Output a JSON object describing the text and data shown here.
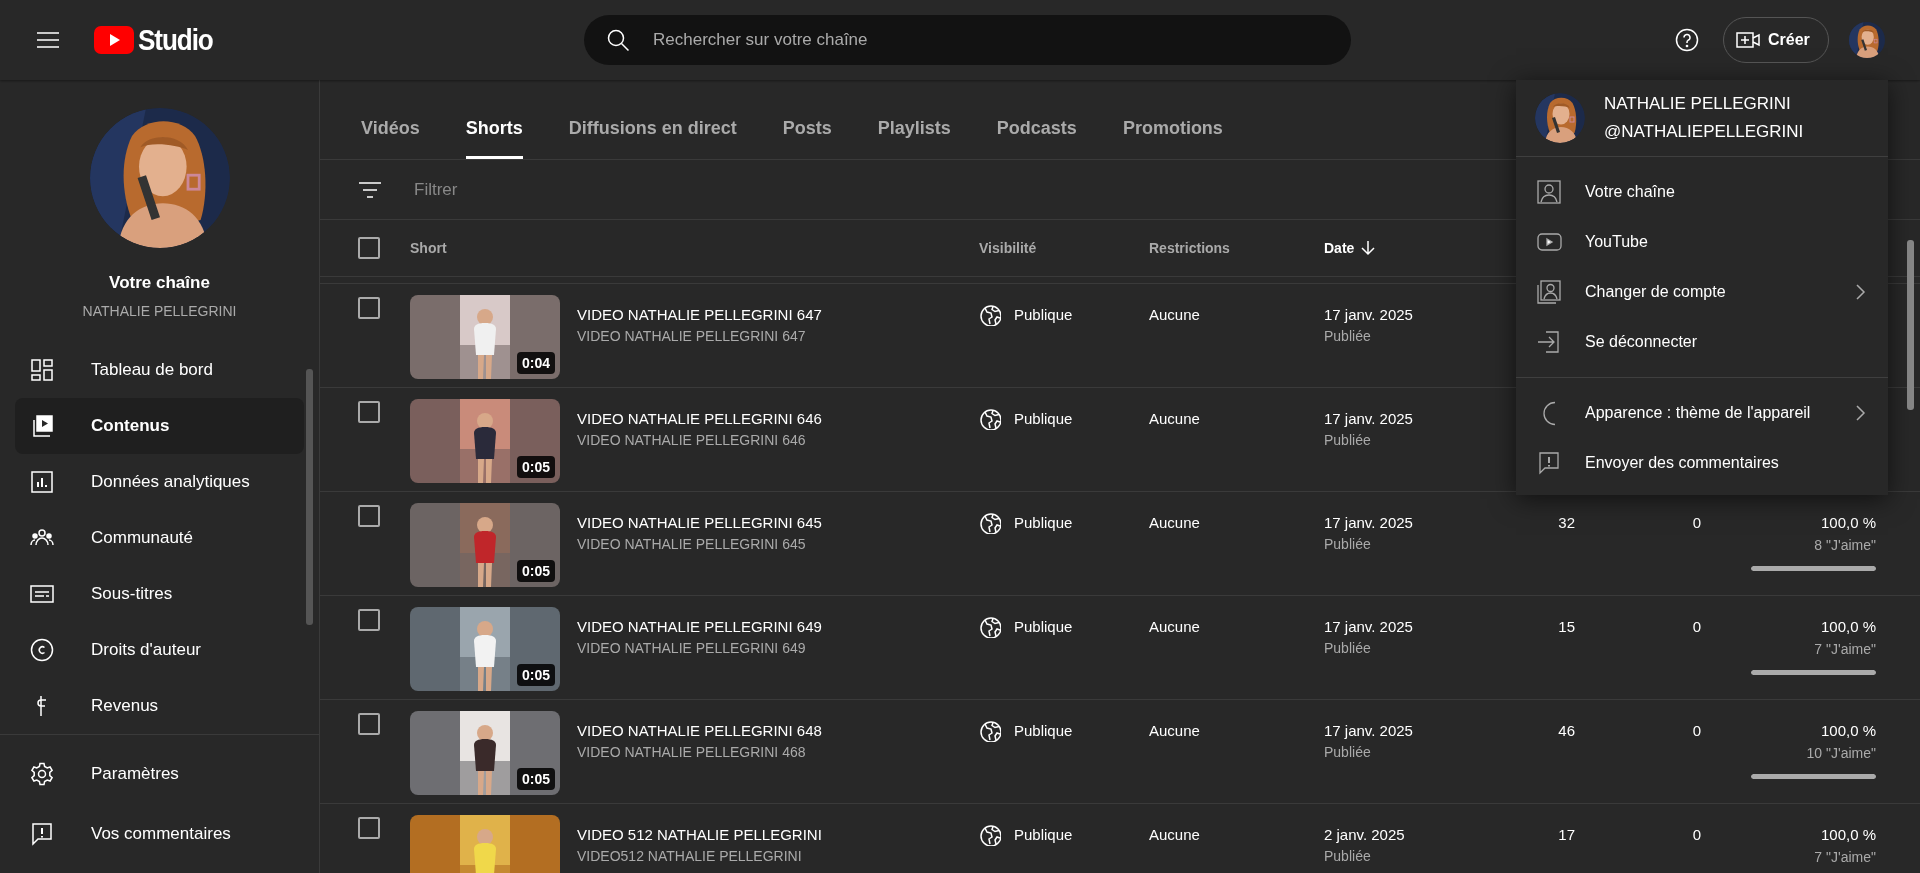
{
  "header": {
    "logo_text": "Studio",
    "search": {
      "placeholder": "Rechercher sur votre chaîne"
    },
    "create_button": "Créer"
  },
  "sidebar": {
    "channel_label": "Votre chaîne",
    "channel_name": "NATHALIE PELLEGRINI",
    "items": [
      {
        "label": "Tableau de bord",
        "selected": false
      },
      {
        "label": "Contenus",
        "selected": true
      },
      {
        "label": "Données analytiques",
        "selected": false
      },
      {
        "label": "Communauté",
        "selected": false
      },
      {
        "label": "Sous-titres",
        "selected": false
      },
      {
        "label": "Droits d'auteur",
        "selected": false
      },
      {
        "label": "Revenus",
        "selected": false
      }
    ],
    "footer_items": [
      {
        "label": "Paramètres"
      },
      {
        "label": "Vos commentaires"
      }
    ]
  },
  "content": {
    "tabs": [
      {
        "label": "Vidéos",
        "selected": false
      },
      {
        "label": "Shorts",
        "selected": true
      },
      {
        "label": "Diffusions en direct",
        "selected": false
      },
      {
        "label": "Posts",
        "selected": false
      },
      {
        "label": "Playlists",
        "selected": false
      },
      {
        "label": "Podcasts",
        "selected": false
      },
      {
        "label": "Promotions",
        "selected": false
      }
    ],
    "filter": {
      "placeholder": "Filtrer"
    },
    "header_checked": false,
    "columns": [
      {
        "label": "Short",
        "sorted": false
      },
      {
        "label": "Visibilité",
        "sorted": false
      },
      {
        "label": "Restrictions",
        "sorted": false
      },
      {
        "label": "Date",
        "sorted": true
      }
    ],
    "rows": [
      {
        "checked": false,
        "duration": "0:04",
        "title": "VIDEO NATHALIE PELLEGRINI 647",
        "description": "VIDEO NATHALIE PELLEGRINI 647",
        "visibility": "Publique",
        "restrictions": "Aucune",
        "date": "17 janv. 2025",
        "status": "Publiée"
      },
      {
        "checked": false,
        "duration": "0:05",
        "title": "VIDEO NATHALIE PELLEGRINI 646",
        "description": "VIDEO NATHALIE PELLEGRINI 646",
        "visibility": "Publique",
        "restrictions": "Aucune",
        "date": "17 janv. 2025",
        "status": "Publiée"
      },
      {
        "checked": false,
        "duration": "0:05",
        "title": "VIDEO NATHALIE PELLEGRINI 645",
        "description": "VIDEO NATHALIE PELLEGRINI 645",
        "visibility": "Publique",
        "restrictions": "Aucune",
        "date": "17 janv. 2025",
        "status": "Publiée",
        "views": "32",
        "comments": "0",
        "likes_ratio": "100,0 %",
        "likes": "8 \"J'aime\"",
        "level": 1
      },
      {
        "checked": false,
        "duration": "0:05",
        "title": "VIDEO NATHALIE PELLEGRINI 649",
        "description": "VIDEO NATHALIE PELLEGRINI 649",
        "visibility": "Publique",
        "restrictions": "Aucune",
        "date": "17 janv. 2025",
        "status": "Publiée",
        "views": "15",
        "comments": "0",
        "likes_ratio": "100,0 %",
        "likes": "7 \"J'aime\"",
        "level": 1
      },
      {
        "checked": false,
        "duration": "0:05",
        "title": "VIDEO NATHALIE PELLEGRINI 648",
        "description": "VIDEO NATHALIE PELLEGRINI 468",
        "visibility": "Publique",
        "restrictions": "Aucune",
        "date": "17 janv. 2025",
        "status": "Publiée",
        "views": "46",
        "comments": "0",
        "likes_ratio": "100,0 %",
        "likes": "10 \"J'aime\"",
        "level": 1
      },
      {
        "checked": false,
        "title": "VIDEO 512 NATHALIE PELLEGRINI",
        "description": "VIDEO512 NATHALIE PELLEGRINI",
        "visibility": "Publique",
        "restrictions": "Aucune",
        "date": "2 janv. 2025",
        "status": "Publiée",
        "views": "17",
        "comments": "0",
        "likes_ratio": "100,0 %",
        "likes": "7 \"J'aime\""
      }
    ]
  },
  "account_menu": {
    "name": "NATHALIE PELLEGRINI",
    "handle": "@NATHALIEPELLEGRINI",
    "sections": [
      [
        {
          "label": "Votre chaîne",
          "submenu": false
        },
        {
          "label": "YouTube",
          "submenu": false
        },
        {
          "label": "Changer de compte",
          "submenu": true
        },
        {
          "label": "Se déconnecter",
          "submenu": false
        }
      ],
      [
        {
          "label": "Apparence : thème de l'appareil",
          "submenu": true
        },
        {
          "label": "Envoyer des commentaires",
          "submenu": false
        }
      ]
    ]
  }
}
